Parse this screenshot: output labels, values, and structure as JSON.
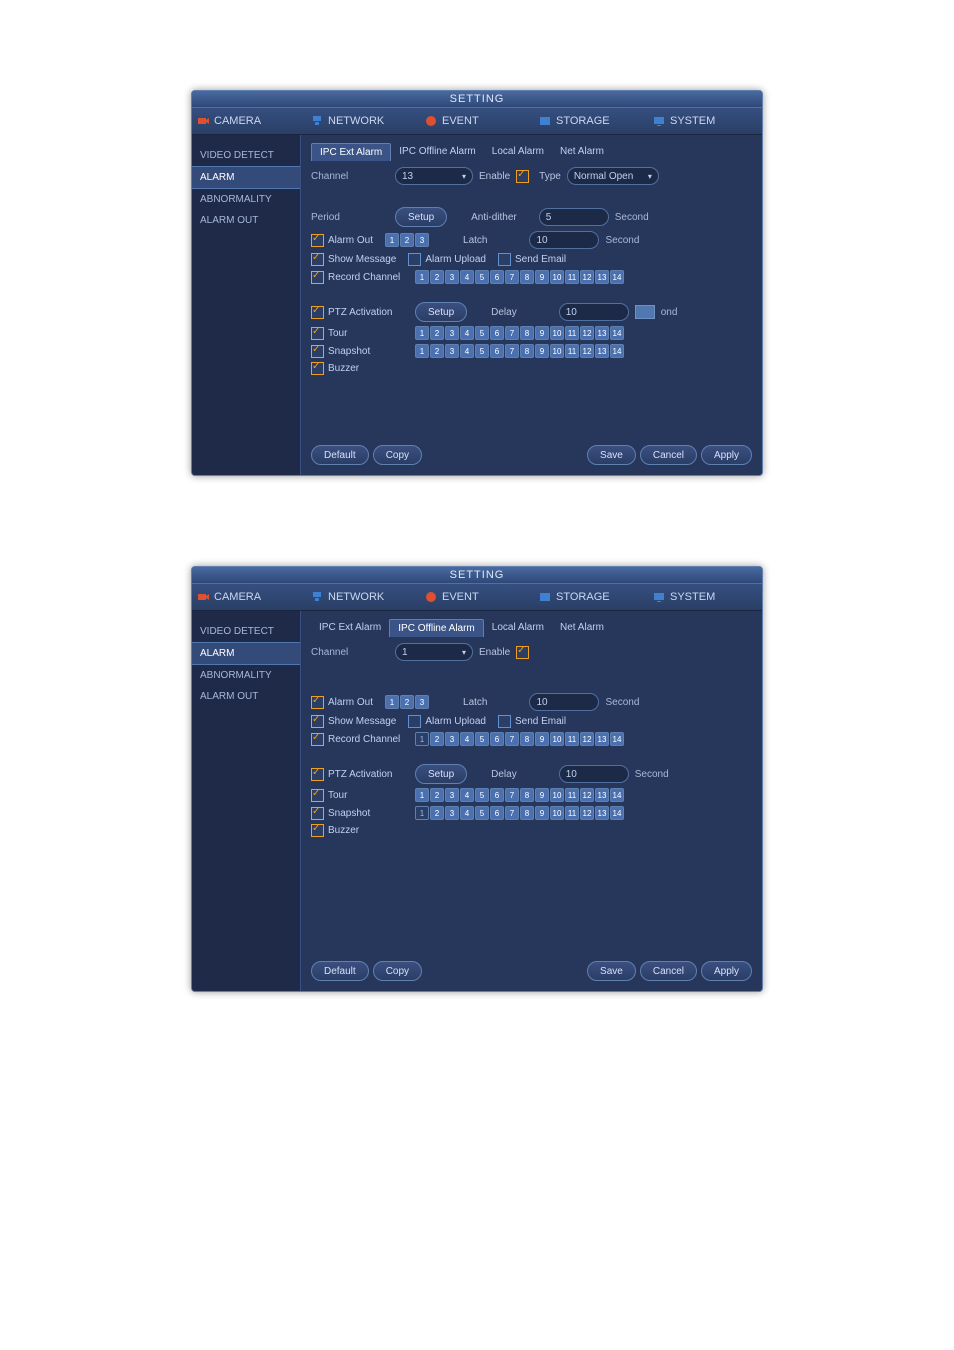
{
  "window1": {
    "title": "SETTING",
    "tabs": [
      "CAMERA",
      "NETWORK",
      "EVENT",
      "STORAGE",
      "SYSTEM"
    ],
    "sidebar": [
      "VIDEO DETECT",
      "ALARM",
      "ABNORMALITY",
      "ALARM OUT"
    ],
    "sidebar_active": "ALARM",
    "subtabs": [
      "IPC Ext Alarm",
      "IPC Offline Alarm",
      "Local Alarm",
      "Net Alarm"
    ],
    "subtab_active": "IPC Ext Alarm",
    "channel_label": "Channel",
    "channel_value": "13",
    "enable_label": "Enable",
    "enable_checked": true,
    "type_label": "Type",
    "type_value": "Normal Open",
    "period_label": "Period",
    "period_button": "Setup",
    "antidither_label": "Anti-dither",
    "antidither_value": "5",
    "second": "Second",
    "alarmout_label": "Alarm Out",
    "alarmout_checked": true,
    "alarmout_ch_on": [
      1,
      2,
      3
    ],
    "latch_label": "Latch",
    "latch_value": "10",
    "showmsg_label": "Show Message",
    "showmsg_checked": true,
    "alarmupload_label": "Alarm Upload",
    "alarmupload_checked": false,
    "sendemail_label": "Send Email",
    "sendemail_checked": false,
    "recordch_label": "Record Channel",
    "recordch_checked": true,
    "recordch_on": [
      1,
      2,
      3,
      4,
      5,
      6,
      7,
      8,
      9,
      10,
      11,
      12,
      13,
      14
    ],
    "ptz_label": "PTZ Activation",
    "ptz_checked": true,
    "ptz_button": "Setup",
    "delay_label": "Delay",
    "delay_value": "10",
    "delay_unit_suffix": "ond",
    "tour_label": "Tour",
    "tour_checked": true,
    "tour_on": [
      1,
      2,
      3,
      4,
      5,
      6,
      7,
      8,
      9,
      10,
      11,
      12,
      13,
      14
    ],
    "snapshot_label": "Snapshot",
    "snapshot_checked": true,
    "snapshot_on": [
      1,
      2,
      3,
      4,
      5,
      6,
      7,
      8,
      9,
      10,
      11,
      12,
      13,
      14
    ],
    "buzzer_label": "Buzzer",
    "buzzer_checked": true,
    "footer": {
      "default": "Default",
      "copy": "Copy",
      "save": "Save",
      "cancel": "Cancel",
      "apply": "Apply"
    }
  },
  "window2": {
    "title": "SETTING",
    "tabs": [
      "CAMERA",
      "NETWORK",
      "EVENT",
      "STORAGE",
      "SYSTEM"
    ],
    "sidebar": [
      "VIDEO DETECT",
      "ALARM",
      "ABNORMALITY",
      "ALARM OUT"
    ],
    "sidebar_active": "ALARM",
    "subtabs": [
      "IPC Ext Alarm",
      "IPC Offline Alarm",
      "Local Alarm",
      "Net Alarm"
    ],
    "subtab_active": "IPC Offline Alarm",
    "channel_label": "Channel",
    "channel_value": "1",
    "enable_label": "Enable",
    "enable_checked": true,
    "alarmout_label": "Alarm Out",
    "alarmout_checked": true,
    "alarmout_ch_on": [
      1,
      2,
      3
    ],
    "latch_label": "Latch",
    "latch_value": "10",
    "second": "Second",
    "showmsg_label": "Show Message",
    "showmsg_checked": true,
    "alarmupload_label": "Alarm Upload",
    "alarmupload_checked": false,
    "sendemail_label": "Send Email",
    "sendemail_checked": false,
    "recordch_label": "Record Channel",
    "recordch_checked": true,
    "recordch_on": [
      2,
      3,
      4,
      5,
      6,
      7,
      8,
      9,
      10,
      11,
      12,
      13,
      14
    ],
    "ptz_label": "PTZ Activation",
    "ptz_checked": true,
    "ptz_button": "Setup",
    "delay_label": "Delay",
    "delay_value": "10",
    "tour_label": "Tour",
    "tour_checked": true,
    "tour_on": [
      1,
      2,
      3,
      4,
      5,
      6,
      7,
      8,
      9,
      10,
      11,
      12,
      13,
      14
    ],
    "snapshot_label": "Snapshot",
    "snapshot_checked": true,
    "snapshot_on": [
      2,
      3,
      4,
      5,
      6,
      7,
      8,
      9,
      10,
      11,
      12,
      13,
      14
    ],
    "buzzer_label": "Buzzer",
    "buzzer_checked": true,
    "footer": {
      "default": "Default",
      "copy": "Copy",
      "save": "Save",
      "cancel": "Cancel",
      "apply": "Apply"
    }
  }
}
